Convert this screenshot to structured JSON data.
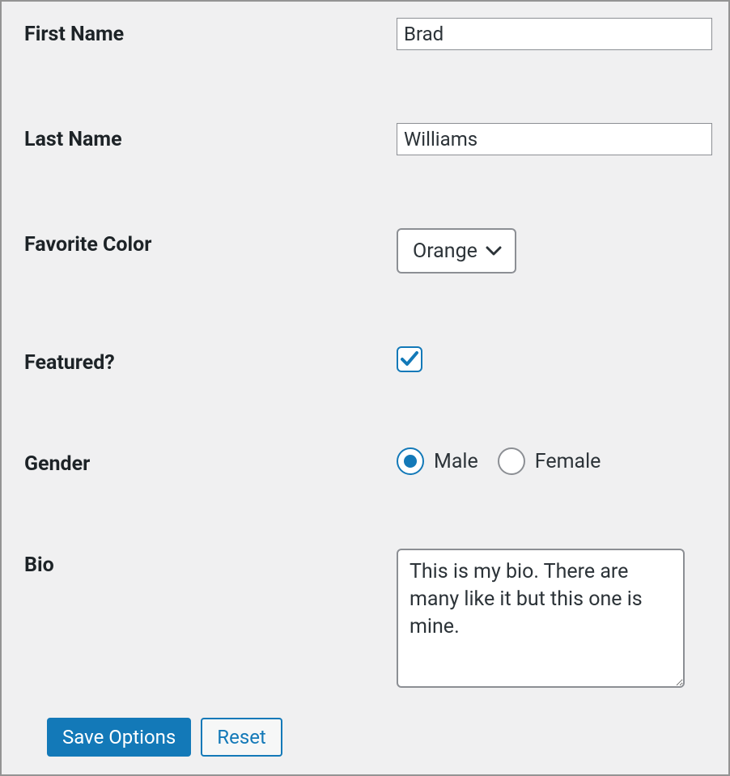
{
  "labels": {
    "first_name": "First Name",
    "last_name": "Last Name",
    "favorite_color": "Favorite Color",
    "featured": "Featured?",
    "gender": "Gender",
    "bio": "Bio"
  },
  "values": {
    "first_name": "Brad",
    "last_name": "Williams",
    "favorite_color": "Orange",
    "featured_checked": true,
    "gender_selected": "male",
    "bio": "This is my bio. There are many like it but this one is mine."
  },
  "gender_options": {
    "male": "Male",
    "female": "Female"
  },
  "buttons": {
    "save": "Save Options",
    "reset": "Reset"
  },
  "colors": {
    "accent": "#1379b8",
    "border": "#8c8f94",
    "panel_bg": "#f0f0f1"
  }
}
